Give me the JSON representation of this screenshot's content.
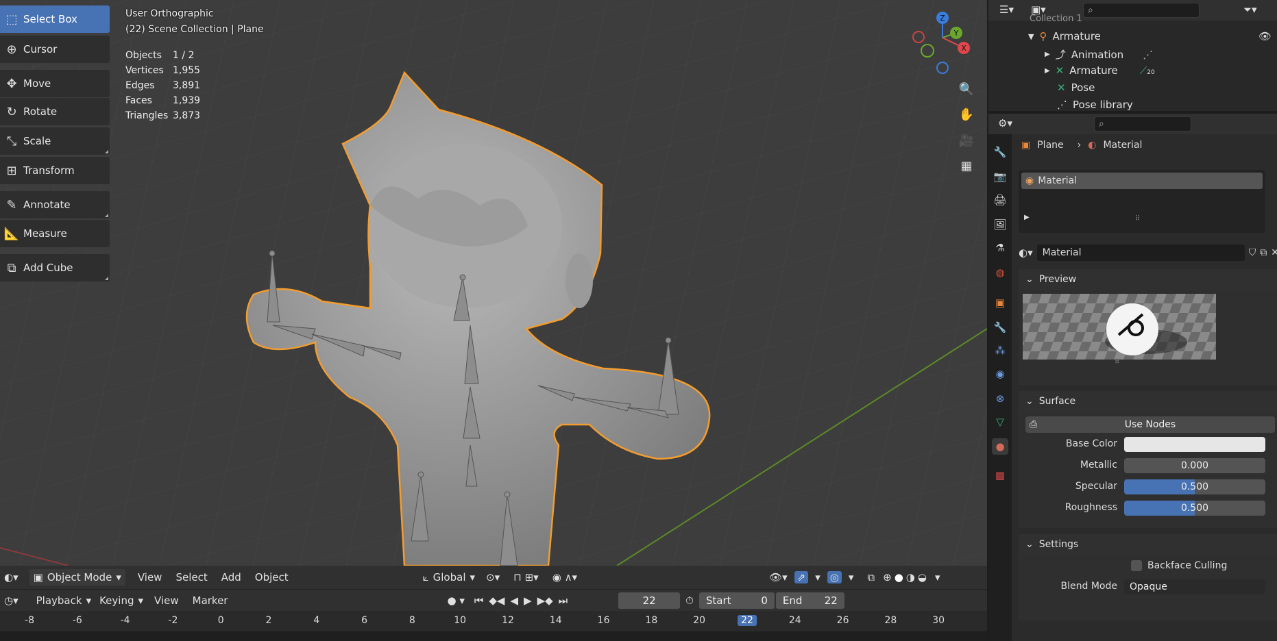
{
  "viewport": {
    "view_name": "User Orthographic",
    "collection_info": "(22) Scene Collection | Plane",
    "stats": [
      {
        "label": "Objects",
        "value": "1 / 2"
      },
      {
        "label": "Vertices",
        "value": "1,955"
      },
      {
        "label": "Edges",
        "value": "3,891"
      },
      {
        "label": "Faces",
        "value": "1,939"
      },
      {
        "label": "Triangles",
        "value": "3,873"
      }
    ],
    "gizmo": {
      "z": "Z",
      "y": "Y",
      "x": "X"
    }
  },
  "toolbar": {
    "tools": [
      {
        "label": "Select Box",
        "icon": "select-box-icon"
      },
      {
        "label": "Cursor",
        "icon": "cursor-icon"
      },
      {
        "label": "Move",
        "icon": "move-icon"
      },
      {
        "label": "Rotate",
        "icon": "rotate-icon"
      },
      {
        "label": "Scale",
        "icon": "scale-icon"
      },
      {
        "label": "Transform",
        "icon": "transform-icon"
      },
      {
        "label": "Annotate",
        "icon": "annotate-icon"
      },
      {
        "label": "Measure",
        "icon": "measure-icon"
      },
      {
        "label": "Add Cube",
        "icon": "add-cube-icon"
      }
    ]
  },
  "viewport_header": {
    "mode": "Object Mode",
    "menus": [
      "View",
      "Select",
      "Add",
      "Object"
    ],
    "orientation": "Global"
  },
  "timeline": {
    "menus": {
      "playback": "Playback",
      "keying": "Keying",
      "view": "View",
      "marker": "Marker"
    },
    "current_frame": "22",
    "start_label": "Start",
    "start_value": "0",
    "end_label": "End",
    "end_value": "22",
    "ruler": [
      "-8",
      "-6",
      "-4",
      "-2",
      "0",
      "2",
      "4",
      "6",
      "8",
      "10",
      "12",
      "14",
      "16",
      "18",
      "20",
      "22",
      "24",
      "26",
      "28",
      "30"
    ]
  },
  "outliner": {
    "top_clipped": "Collection 1",
    "items": [
      {
        "label": "Armature"
      },
      {
        "label": "Animation"
      },
      {
        "label": "Armature",
        "badge": "20"
      },
      {
        "label": "Pose"
      },
      {
        "label": "Pose library"
      }
    ]
  },
  "properties": {
    "breadcrumb_object": "Plane",
    "breadcrumb_material": "Material",
    "slot_name": "Material",
    "material_name": "Material",
    "sections": {
      "preview": "Preview",
      "surface": "Surface",
      "settings": "Settings"
    },
    "use_nodes": "Use Nodes",
    "fields": {
      "base_color_label": "Base Color",
      "metallic_label": "Metallic",
      "metallic_value": "0.000",
      "specular_label": "Specular",
      "specular_value": "0.500",
      "roughness_label": "Roughness",
      "roughness_value": "0.500"
    },
    "backface_culling": "Backface Culling",
    "blend_mode_label": "Blend Mode",
    "blend_mode_value": "Opaque"
  },
  "colors": {
    "accent": "#4772b3",
    "selection_outline": "#f39c2f",
    "axis_x": "#e0474c",
    "axis_y": "#6aa82d",
    "axis_z": "#3a7de0"
  }
}
